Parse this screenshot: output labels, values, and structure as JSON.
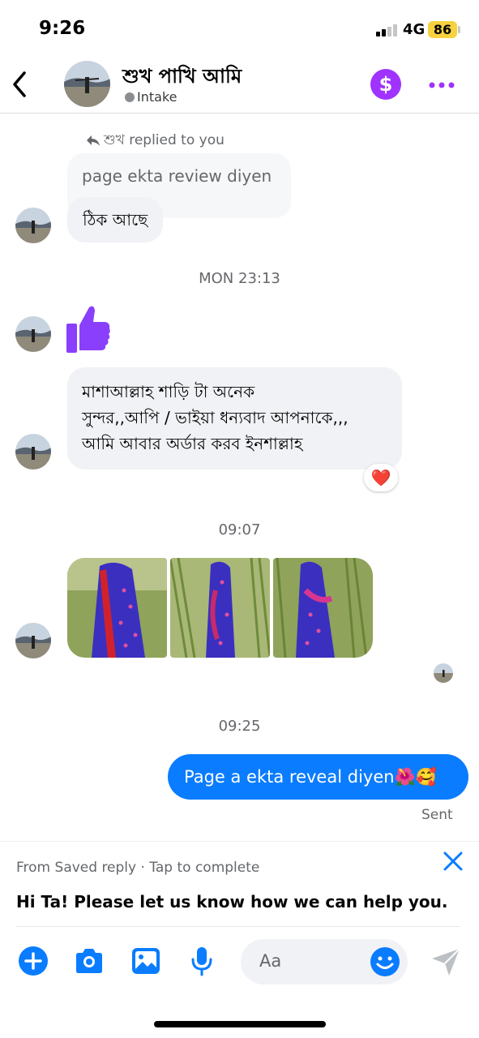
{
  "status_bar": {
    "time": "9:26",
    "network": "4G",
    "battery": "86"
  },
  "header": {
    "contact_name": "শুখ পাখি আমি",
    "label": "Intake"
  },
  "messages": {
    "reply_indicator": "শুখ replied to you",
    "quoted_text": "page ekta review diyen",
    "reply_text": "ঠিক আছে",
    "timestamp_1": "MON 23:13",
    "long_message": {
      "line1": "মাশাআল্লাহ শাড়ি টা অনেক",
      "line2": "সুন্দর,,আপি  / ভাইয়া ধন্যবাদ আপনাকে,,,",
      "line3": "আমি আবার অর্ডার করব ইনশাল্লাহ"
    },
    "reaction": "❤️",
    "timestamp_2": "09:07",
    "timestamp_3": "09:25",
    "outgoing_text": "Page a ekta reveal diyen🌺🥰",
    "sent_status": "Sent"
  },
  "saved_reply": {
    "caption": "From Saved reply · Tap to complete",
    "text": "Hi Ta! Please let us know how we can help you."
  },
  "composer": {
    "placeholder": "Aa"
  },
  "colors": {
    "accent_blue": "#0a7cff",
    "purple": "#a033ff",
    "thumb_purple": "#8a3ffc"
  }
}
